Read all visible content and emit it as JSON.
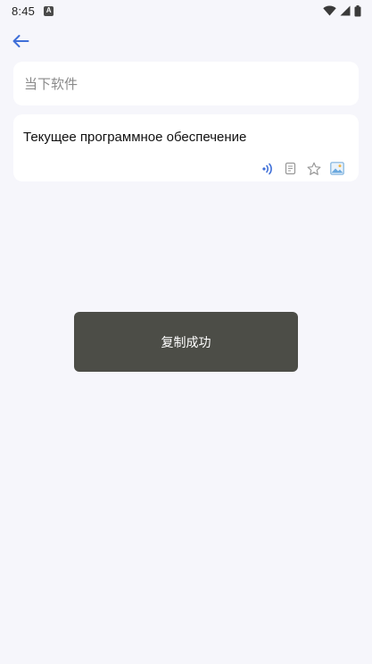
{
  "status_bar": {
    "time": "8:45",
    "notification_icon": "a-box-icon",
    "icons": [
      "wifi-icon",
      "signal-icon",
      "battery-icon"
    ]
  },
  "nav": {
    "back_icon": "arrow-left-icon",
    "accent_color": "#3f6fd8"
  },
  "input": {
    "value": "当下软件"
  },
  "result": {
    "text": "Текущее программное обеспечение",
    "actions": [
      "speaker-icon",
      "copy-icon",
      "star-icon",
      "image-icon"
    ]
  },
  "toast": {
    "message": "复制成功"
  }
}
